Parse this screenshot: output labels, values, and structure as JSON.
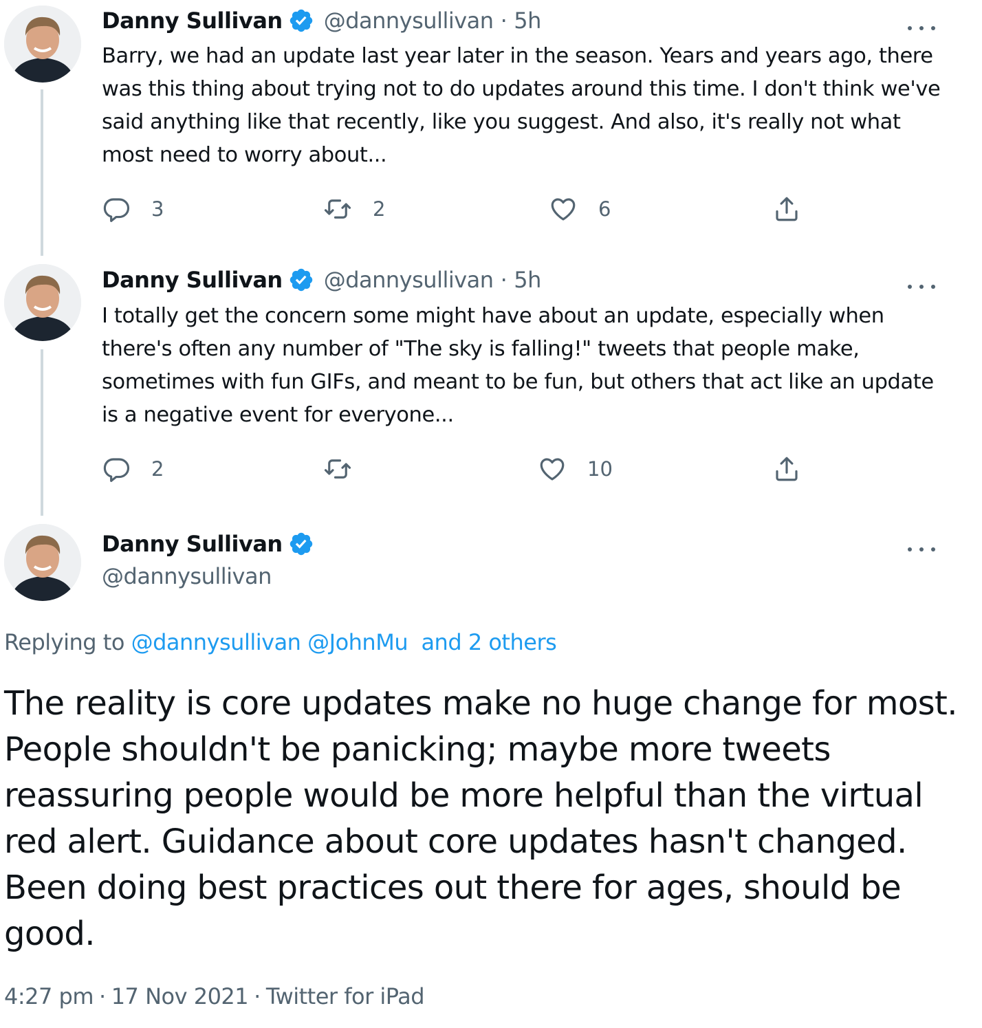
{
  "tweets": [
    {
      "name": "Danny Sullivan",
      "handle": "@dannysullivan",
      "separator": "·",
      "time": "5h",
      "text": "Barry, we had an update last year later in the season. Years and years ago, there was this thing about trying not to do updates around this time. I don't think we've said anything like that recently, like you suggest. And also, it's really not what most need to worry about...",
      "replies": "3",
      "retweets": "2",
      "likes": "6"
    },
    {
      "name": "Danny Sullivan",
      "handle": "@dannysullivan",
      "separator": "·",
      "time": "5h",
      "text": "I totally get the concern some might have about an update, especially when there's often any number of \"The sky is falling!\" tweets that people make, sometimes with fun GIFs, and meant to be fun, but others that act like an update is a negative event for everyone...",
      "replies": "2",
      "retweets": "",
      "likes": "10"
    }
  ],
  "main_tweet": {
    "name": "Danny Sullivan",
    "handle": "@dannysullivan",
    "replying_prefix": "Replying to",
    "replying_users": [
      "@dannysullivan",
      "@JohnMu"
    ],
    "replying_others": "and 2 others",
    "text": "The reality is core updates make no huge change for most. People shouldn't be panicking; maybe more tweets reassuring people would be more helpful than the virtual red alert. Guidance about core updates hasn't changed. Been doing best practices out there for ages, should be good.",
    "time": "4:27 pm",
    "date": "17 Nov 2021",
    "source": "Twitter for iPad",
    "separator": "·"
  },
  "colors": {
    "text_primary": "#0f1419",
    "text_secondary": "#536471",
    "link": "#1d9bf0",
    "verified": "#1d9bf0",
    "thread_line": "#cfd9de"
  },
  "icons": {
    "verified": "verified-badge-icon",
    "reply": "reply-icon",
    "retweet": "retweet-icon",
    "like": "heart-icon",
    "share": "share-icon",
    "more": "more-options-icon"
  }
}
